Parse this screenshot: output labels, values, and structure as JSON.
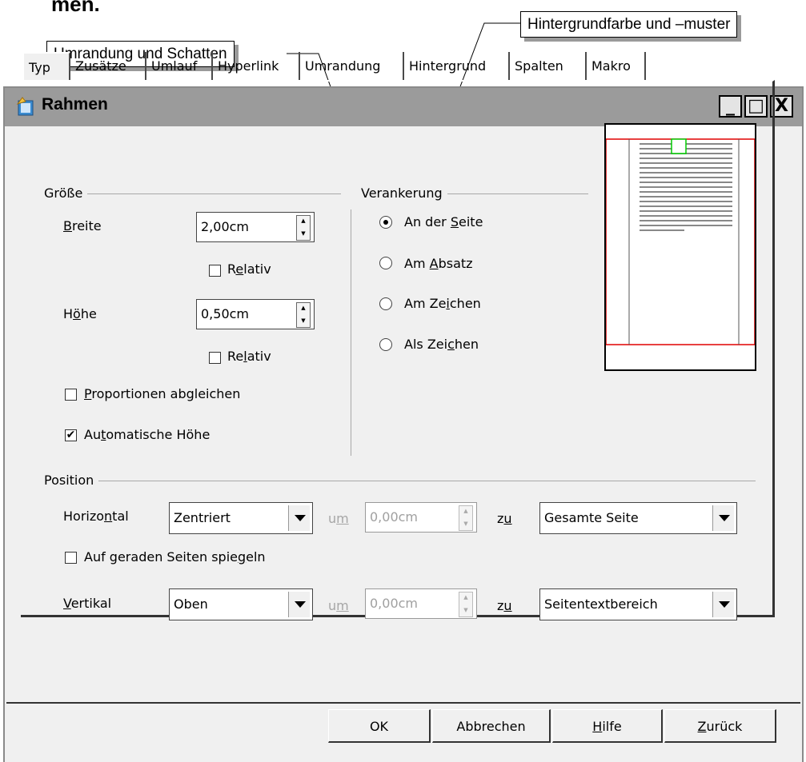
{
  "heading_fragment": "men.",
  "callouts": {
    "border_shadow": "Umrandung und Schatten",
    "background": "Hintergrundfarbe und –muster"
  },
  "window": {
    "title": "Rahmen",
    "icon": "frame-dialog-icon",
    "controls": {
      "minimize": "_",
      "maximize": "□",
      "close": "X"
    }
  },
  "tabs": [
    "Typ",
    "Zusätze",
    "Umlauf",
    "Hyperlink",
    "Umrandung",
    "Hintergrund",
    "Spalten",
    "Makro"
  ],
  "size_group": {
    "label": "Größe",
    "width_label_prefix": "",
    "width_label_mnemonic": "B",
    "width_label_rest": "reite",
    "width_value": "2,00cm",
    "width_relative_a": "R",
    "width_relative_m": "e",
    "width_relative_b": "lativ",
    "height_label_a": "H",
    "height_label_m": "ö",
    "height_label_b": "he",
    "height_value": "0,50cm",
    "height_relative_a": "Re",
    "height_relative_m": "l",
    "height_relative_b": "ativ",
    "proportions_m": "P",
    "proportions_rest": "roportionen abgleichen",
    "auto_height_a": "Au",
    "auto_height_m": "t",
    "auto_height_b": "omatische Höhe",
    "auto_height_checked": true,
    "proportions_checked": false
  },
  "anchor_group": {
    "label": "Verankerung",
    "options": [
      {
        "a": "An der ",
        "m": "S",
        "b": "eite",
        "selected": true
      },
      {
        "a": "Am ",
        "m": "A",
        "b": "bsatz",
        "selected": false
      },
      {
        "a": "Am Ze",
        "m": "i",
        "b": "chen",
        "selected": false
      },
      {
        "a": "Als Zei",
        "m": "c",
        "b": "hen",
        "selected": false
      }
    ]
  },
  "position_group": {
    "label": "Position",
    "horizontal_label_a": "Horizo",
    "horizontal_label_m": "n",
    "horizontal_label_b": "tal",
    "horizontal_value": "Zentriert",
    "by_a": "u",
    "by_m": "m",
    "horizontal_by_value": "0,00cm",
    "to_a": "z",
    "to_m": "u",
    "horizontal_to_value": "Gesamte Seite",
    "mirror_a": "Auf geraden Seiten spie",
    "mirror_m": "g",
    "mirror_b": "eln",
    "vertical_label_m": "V",
    "vertical_label_b": "ertikal",
    "vertical_value": "Oben",
    "vertical_by_value": "0,00cm",
    "vertical_to_value": "Seitentextbereich"
  },
  "buttons": {
    "ok": "OK",
    "cancel": "Abbrechen",
    "help_m": "H",
    "help_b": "ilfe",
    "back_m": "Z",
    "back_b": "urück"
  },
  "colors": {
    "preview_frame": "#e00000",
    "preview_anchor": "#00cc00"
  }
}
